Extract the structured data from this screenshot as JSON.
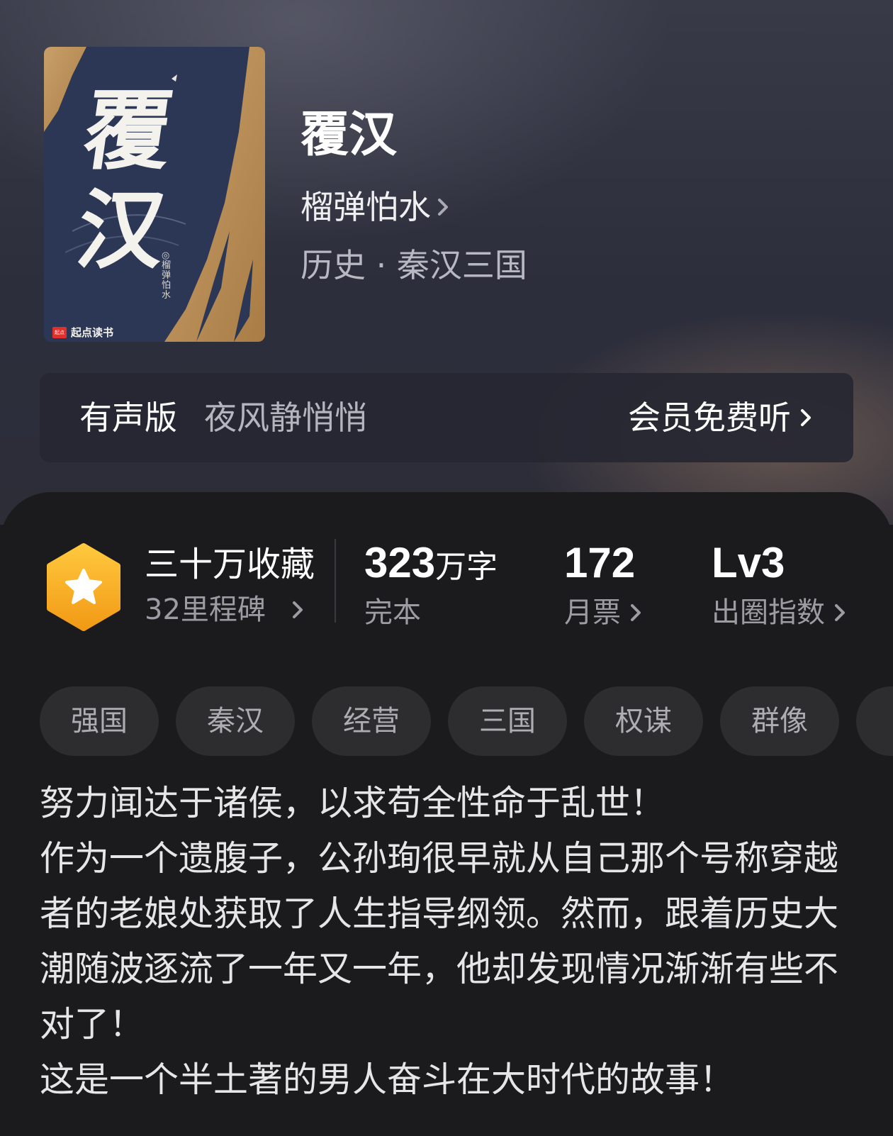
{
  "book": {
    "title": "覆汉",
    "author": "榴弹怕水",
    "genre": "历史 · 秦汉三国",
    "cover": {
      "title_char_1": "覆",
      "title_char_2": "汉",
      "author_text": "◎榴弹怕水",
      "publisher_mark": "起点",
      "publisher": "起点读书"
    }
  },
  "audio": {
    "label": "有声版",
    "narrator": "夜风静悄悄",
    "action": "会员免费听"
  },
  "stats": {
    "collection": "三十万收藏",
    "milestones": "32里程碑",
    "word_count": "323",
    "word_unit": "万字",
    "status": "完本",
    "monthly_votes": "172",
    "monthly_votes_label": "月票",
    "level": "Lv3",
    "level_label": "出圈指数"
  },
  "tags": [
    "强国",
    "秦汉",
    "经营",
    "三国",
    "权谋",
    "群像"
  ],
  "description": [
    "努力闻达于诸侯，以求苟全性命于乱世！",
    "作为一个遗腹子，公孙珣很早就从自己那个号称穿越者的老娘处获取了人生指导纲领。然而，跟着历史大潮随波逐流了一年又一年，他却发现情况渐渐有些不对了！",
    "这是一个半土著的男人奋斗在大时代的故事！"
  ],
  "colors": {
    "badge_orange": "#f5a623",
    "background": "#1b1b1d",
    "tag_bg": "#2d2d30"
  }
}
